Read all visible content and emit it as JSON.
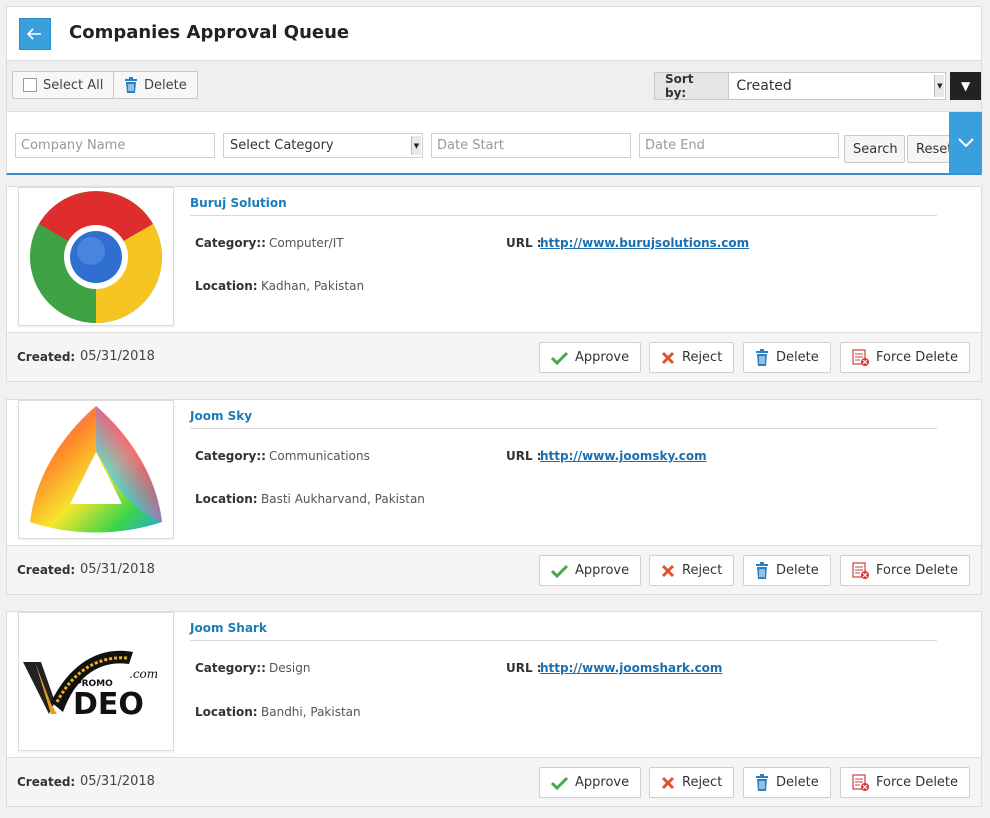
{
  "header": {
    "title": "Companies Approval Queue"
  },
  "toolbar": {
    "select_all": "Select All",
    "delete": "Delete",
    "sort_label": "Sort by:",
    "sort_value": "Created"
  },
  "filters": {
    "company_placeholder": "Company Name",
    "category_value": "Select Category",
    "date_start_placeholder": "Date Start",
    "date_end_placeholder": "Date End",
    "search": "Search",
    "reset": "Reset"
  },
  "labels": {
    "category": "Category::",
    "location": "Location:",
    "url": "URL :",
    "created": "Created:"
  },
  "actions": {
    "approve": "Approve",
    "reject": "Reject",
    "delete": "Delete",
    "force_delete": "Force Delete"
  },
  "companies": [
    {
      "name": "Buruj Solution",
      "category": "Computer/IT",
      "location": "Kadhan, Pakistan",
      "url": "http://www.burujsolutions.com",
      "created": "05/31/2018",
      "logo": "chrome-logo"
    },
    {
      "name": "Joom Sky",
      "category": "Communications",
      "location": "Basti Aukharvand, Pakistan",
      "url": "http://www.joomsky.com",
      "created": "05/31/2018",
      "logo": "rainbow-triangle-logo"
    },
    {
      "name": "Joom Shark",
      "category": "Design",
      "location": "Bandhi, Pakistan",
      "url": "http://www.joomshark.com",
      "created": "05/31/2018",
      "logo": "promo-video-logo",
      "logo_text": {
        "promo": "PROMO",
        "video": "DEO",
        "com": ".com"
      }
    }
  ]
}
